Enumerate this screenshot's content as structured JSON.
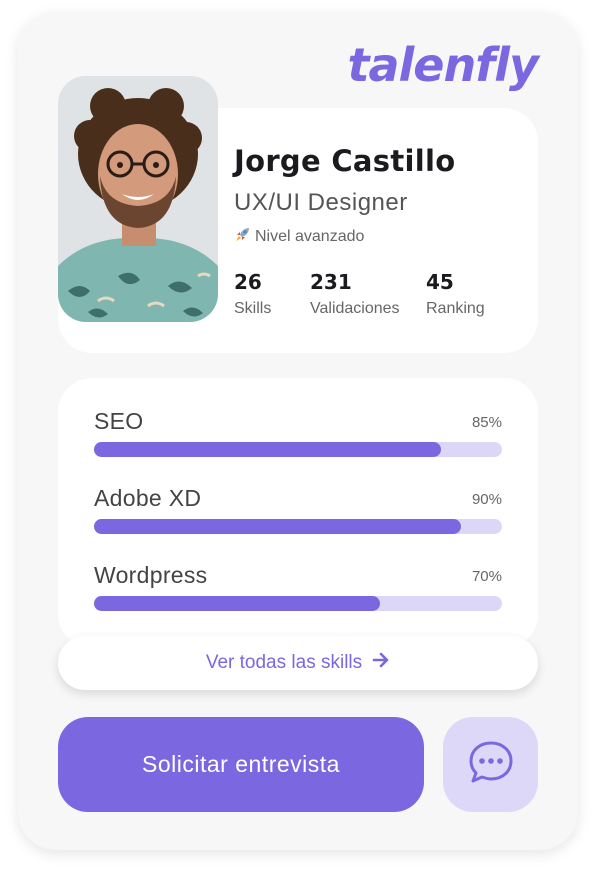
{
  "brand": {
    "logo_text": "talenfly"
  },
  "profile": {
    "name": "Jorge Castillo",
    "role": "UX/UI Designer",
    "level_icon": "rocket-icon",
    "level": "Nivel avanzado",
    "stats": [
      {
        "value": "26",
        "label": "Skills"
      },
      {
        "value": "231",
        "label": "Validaciones"
      },
      {
        "value": "45",
        "label": "Ranking"
      }
    ]
  },
  "skills": [
    {
      "name": "SEO",
      "percent_label": "85%",
      "level": 0.85
    },
    {
      "name": "Adobe XD",
      "percent_label": "90%",
      "level": 0.9
    },
    {
      "name": "Wordpress",
      "percent_label": "70%",
      "level": 0.7
    }
  ],
  "actions": {
    "see_all_label": "Ver todas las skills",
    "see_all_icon": "arrow-right-icon",
    "interview_label": "Solicitar entrevista",
    "chat_icon": "chat-bubble-icon"
  },
  "colors": {
    "accent": "#7b68e0",
    "accent_light": "#dcd7f7",
    "card_bg": "#f7f7f8"
  }
}
